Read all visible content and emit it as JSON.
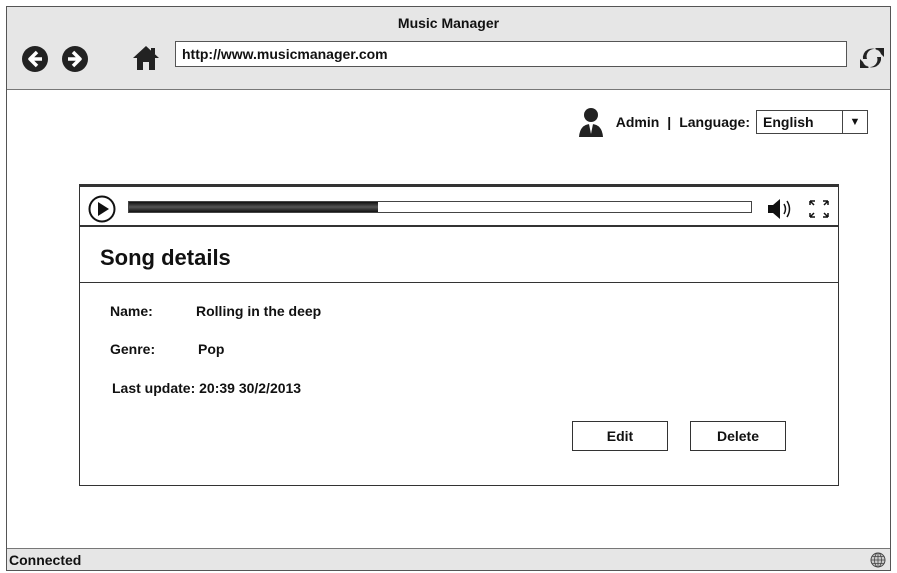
{
  "window": {
    "title": "Music Manager"
  },
  "navigation": {
    "url": "http://www.musicmanager.com",
    "icons": [
      "back-icon",
      "forward-icon",
      "home-icon",
      "refresh-icon"
    ]
  },
  "user": {
    "name": "Admin",
    "separator": "|",
    "language_label": "Language:",
    "language_value": "English",
    "icons": [
      "user-icon",
      "dropdown-caret-icon"
    ]
  },
  "player": {
    "progress": 0.4,
    "icons": [
      "play-icon",
      "volume-icon",
      "fullscreen-icon"
    ]
  },
  "song": {
    "heading": "Song details",
    "name_label": "Name:",
    "name_value": "Rolling in the deep",
    "genre_label": "Genre:",
    "genre_value": "Pop",
    "last_update": "Last update: 20:39 30/2/2013"
  },
  "actions": {
    "edit_label": "Edit",
    "delete_label": "Delete"
  },
  "status": {
    "text": "Connected",
    "icons": [
      "globe-icon"
    ]
  }
}
